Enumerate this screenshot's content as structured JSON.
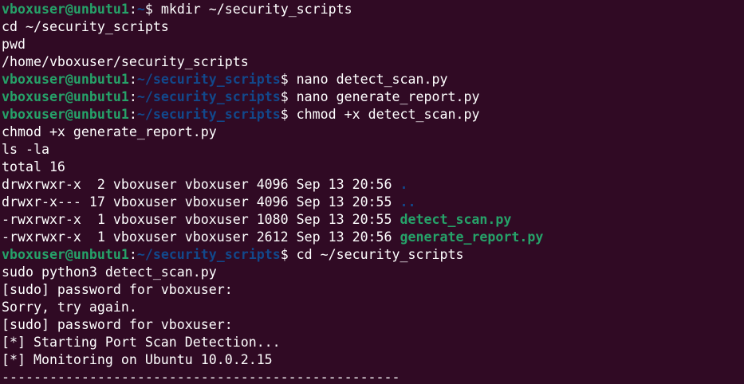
{
  "terminal": {
    "prompt_user_host": "vboxuser@unbutu1",
    "lines": [
      {
        "kind": "prompt",
        "path": "~",
        "cmd": " mkdir ~/security_scripts"
      },
      {
        "kind": "text",
        "text": "cd ~/security_scripts"
      },
      {
        "kind": "text",
        "text": "pwd"
      },
      {
        "kind": "text",
        "text": "/home/vboxuser/security_scripts"
      },
      {
        "kind": "prompt",
        "path": "~/security_scripts",
        "cmd": " nano detect_scan.py"
      },
      {
        "kind": "prompt",
        "path": "~/security_scripts",
        "cmd": " nano generate_report.py"
      },
      {
        "kind": "prompt",
        "path": "~/security_scripts",
        "cmd": " chmod +x detect_scan.py"
      },
      {
        "kind": "text",
        "text": "chmod +x generate_report.py"
      },
      {
        "kind": "text",
        "text": "ls -la"
      },
      {
        "kind": "text",
        "text": "total 16"
      },
      {
        "kind": "ls",
        "meta": "drwxrwxr-x  2 vboxuser vboxuser 4096 Sep 13 20:56 ",
        "name": ".",
        "type": "dir"
      },
      {
        "kind": "ls",
        "meta": "drwxr-x--- 17 vboxuser vboxuser 4096 Sep 13 20:55 ",
        "name": "..",
        "type": "dir"
      },
      {
        "kind": "ls",
        "meta": "-rwxrwxr-x  1 vboxuser vboxuser 1080 Sep 13 20:55 ",
        "name": "detect_scan.py",
        "type": "exe"
      },
      {
        "kind": "ls",
        "meta": "-rwxrwxr-x  1 vboxuser vboxuser 2612 Sep 13 20:56 ",
        "name": "generate_report.py",
        "type": "exe"
      },
      {
        "kind": "prompt",
        "path": "~/security_scripts",
        "cmd": " cd ~/security_scripts"
      },
      {
        "kind": "text",
        "text": "sudo python3 detect_scan.py"
      },
      {
        "kind": "text",
        "text": "[sudo] password for vboxuser:"
      },
      {
        "kind": "text",
        "text": "Sorry, try again."
      },
      {
        "kind": "text",
        "text": "[sudo] password for vboxuser:"
      },
      {
        "kind": "text",
        "text": "[*] Starting Port Scan Detection..."
      },
      {
        "kind": "text",
        "text": "[*] Monitoring on Ubuntu 10.0.2.15"
      },
      {
        "kind": "text",
        "text": "--------------------------------------------------"
      }
    ]
  },
  "colors": {
    "background": "#300a24",
    "user_host": "#26a269",
    "path": "#12488b",
    "executable": "#26a269",
    "directory": "#12488b",
    "text": "#ffffff"
  }
}
